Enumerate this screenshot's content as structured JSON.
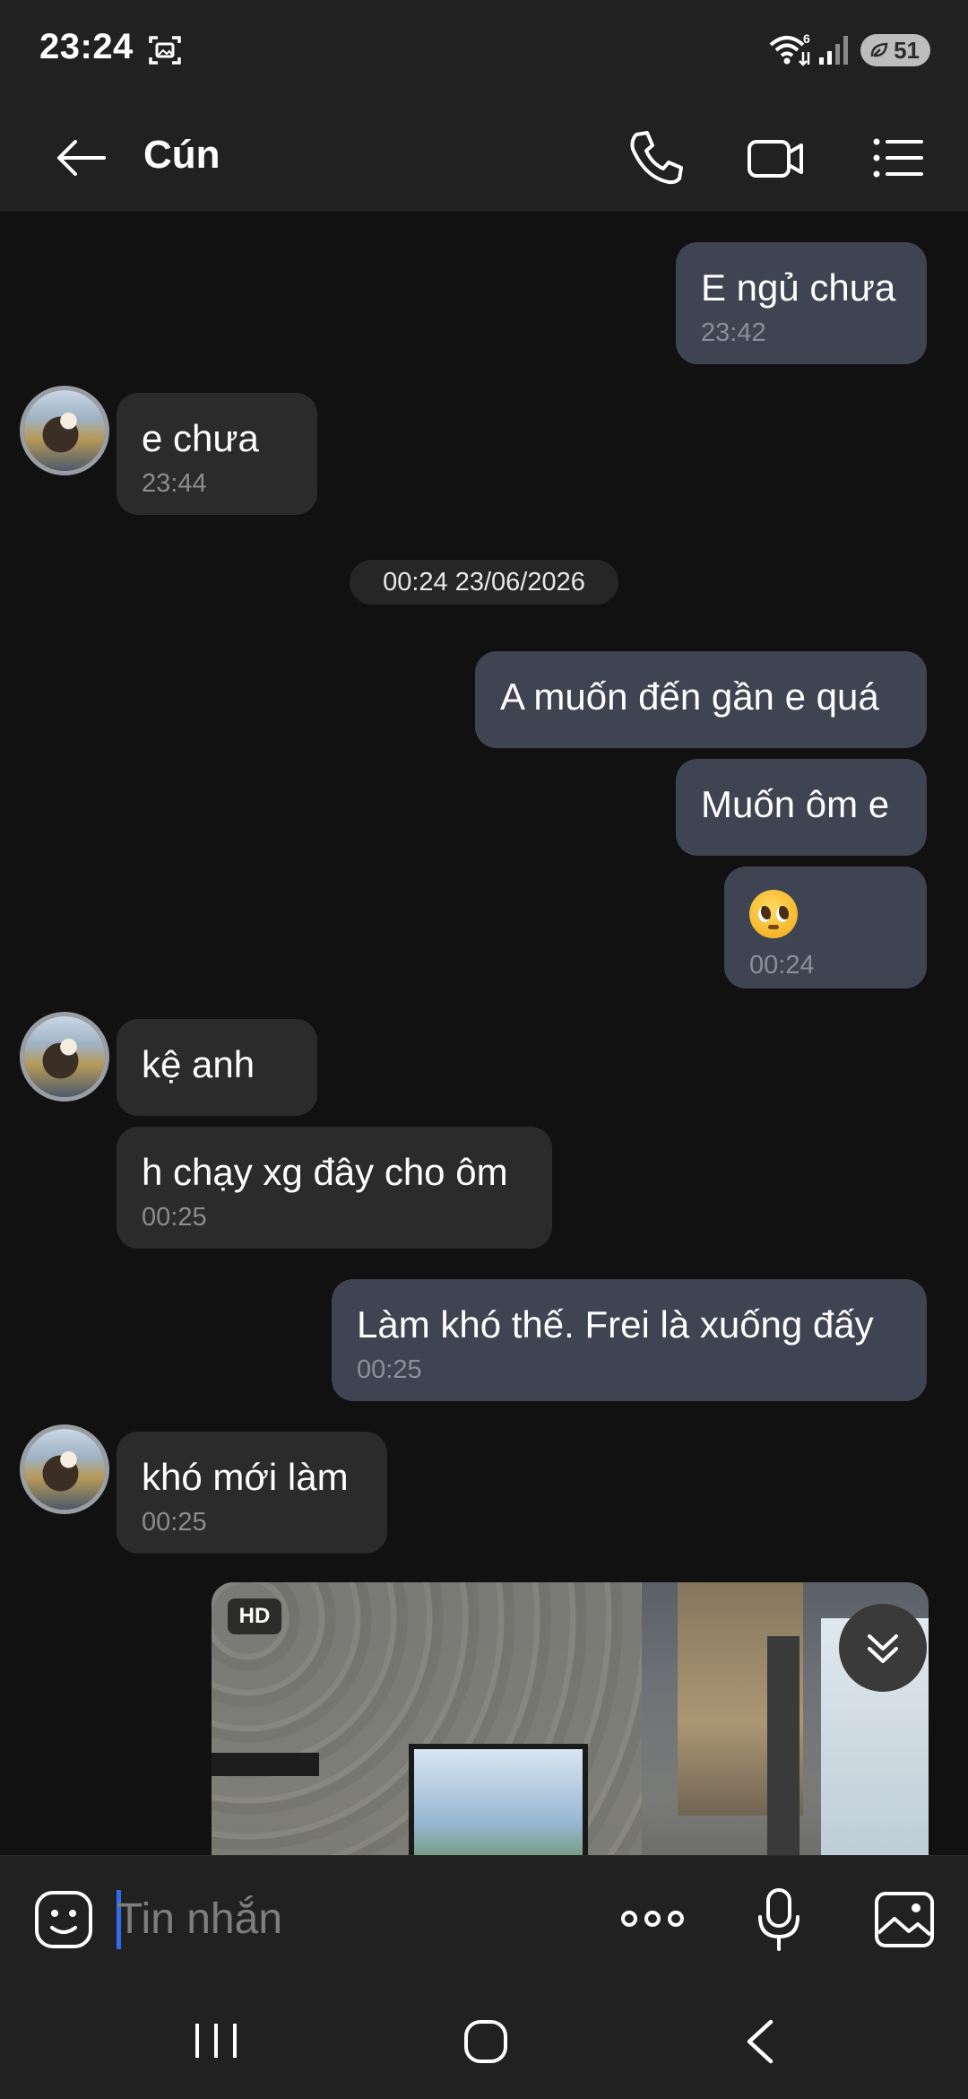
{
  "status_bar": {
    "time": "23:24",
    "wifi_badge": "6",
    "battery": "51",
    "icons": [
      "screenshot-capture-icon",
      "wifi-icon",
      "signal-icon",
      "battery-saver-icon"
    ]
  },
  "header": {
    "contact_name": "Cún",
    "icons": [
      "back-arrow-icon",
      "phone-icon",
      "video-camera-icon",
      "list-menu-icon"
    ]
  },
  "messages": [
    {
      "direction": "out",
      "text": "E ngủ chưa",
      "time": "23:42"
    },
    {
      "direction": "in",
      "text": "e chưa",
      "time": "23:44"
    },
    {
      "direction": "out",
      "text": "A muốn đến gần e quá",
      "time": ""
    },
    {
      "direction": "out",
      "text": "Muốn ôm e",
      "time": ""
    },
    {
      "direction": "out",
      "emoji": "pleading-face",
      "time": "00:24"
    },
    {
      "direction": "in",
      "text": "kệ anh",
      "time": ""
    },
    {
      "direction": "in",
      "text": "h chạy xg đây cho ôm",
      "time": "00:25"
    },
    {
      "direction": "out",
      "text": "Làm khó thế. Frei là xuống đấy",
      "time": "00:25"
    },
    {
      "direction": "in",
      "text": "khó mới làm",
      "time": "00:25"
    }
  ],
  "date_separator": "00:24 23/06/2026",
  "image_message": {
    "badge": "HD"
  },
  "input": {
    "placeholder": "Tin nhắn",
    "value": ""
  },
  "colors": {
    "background": "#111111",
    "bar": "#212121",
    "outgoing_bubble": "#3e4451",
    "incoming_bubble": "#2b2b2b",
    "cursor": "#2f6df0"
  }
}
